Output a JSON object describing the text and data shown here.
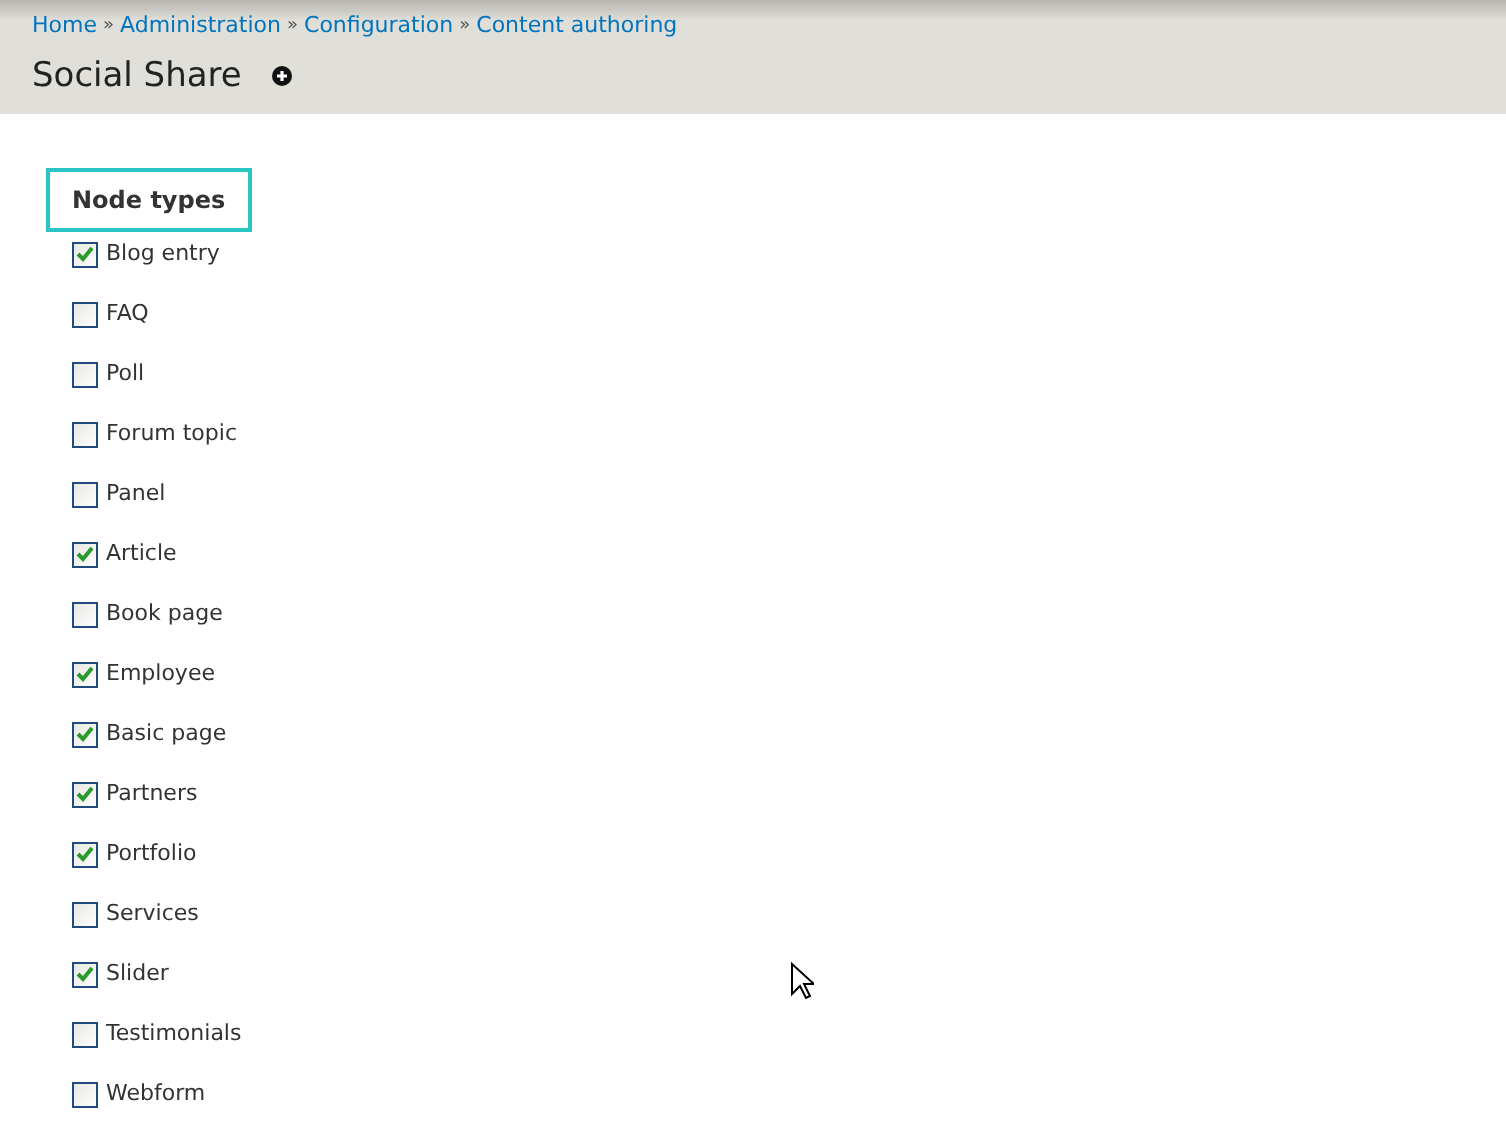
{
  "breadcrumb": [
    "Home",
    "Administration",
    "Configuration",
    "Content authoring"
  ],
  "breadcrumb_separator": "»",
  "title": "Social Share",
  "fieldset": {
    "legend": "Node types",
    "options": [
      {
        "label": "Blog entry",
        "checked": true
      },
      {
        "label": "FAQ",
        "checked": false
      },
      {
        "label": "Poll",
        "checked": false
      },
      {
        "label": "Forum topic",
        "checked": false
      },
      {
        "label": "Panel",
        "checked": false
      },
      {
        "label": "Article",
        "checked": true
      },
      {
        "label": "Book page",
        "checked": false
      },
      {
        "label": "Employee",
        "checked": true
      },
      {
        "label": "Basic page",
        "checked": true
      },
      {
        "label": "Partners",
        "checked": true
      },
      {
        "label": "Portfolio",
        "checked": true
      },
      {
        "label": "Services",
        "checked": false
      },
      {
        "label": "Slider",
        "checked": true
      },
      {
        "label": "Testimonials",
        "checked": false
      },
      {
        "label": "Webform",
        "checked": false
      }
    ]
  }
}
